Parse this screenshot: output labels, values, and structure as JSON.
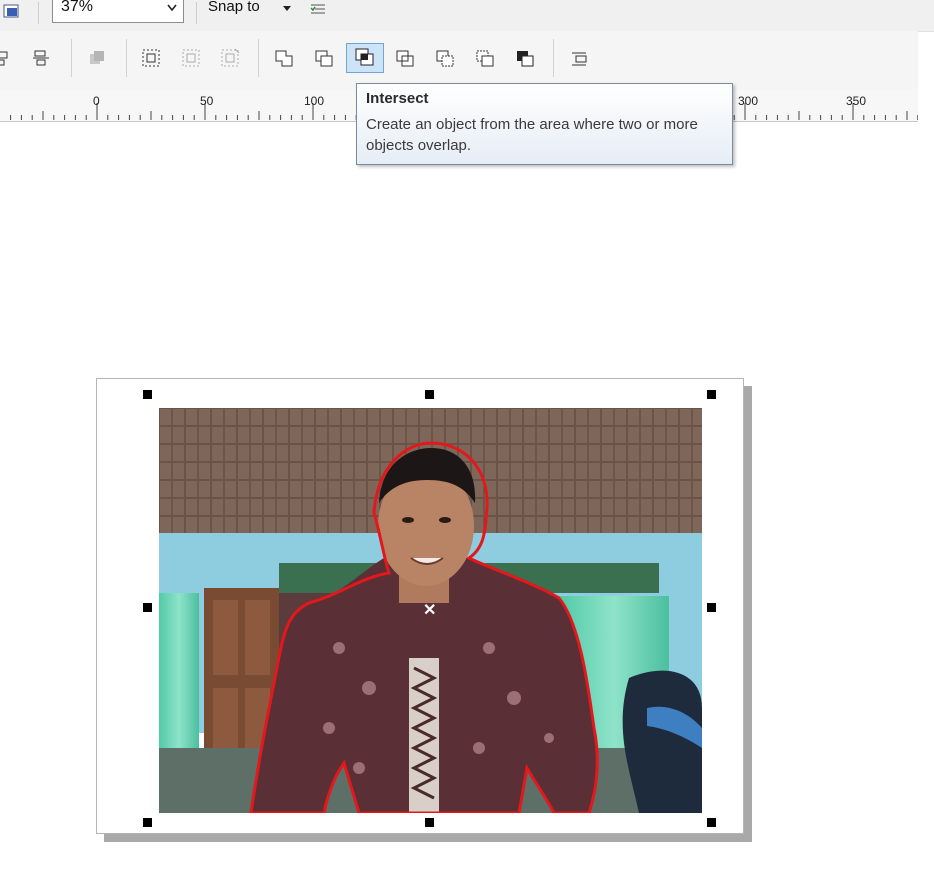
{
  "property_bar": {
    "zoom_value": "37%",
    "snap_label": "Snap to"
  },
  "toolbar": {
    "buttons": [
      "align-distribute",
      "align-page",
      "combine",
      "group",
      "ungroup",
      "ungroup-all",
      "weld",
      "trim",
      "intersect",
      "simplify",
      "front-minus-back",
      "back-minus-front",
      "boundary",
      "create-boundary"
    ],
    "active_button": "intersect"
  },
  "ruler": {
    "labels": [
      "0",
      "50",
      "100",
      "300",
      "350"
    ]
  },
  "tooltip": {
    "title": "Intersect",
    "description": "Create an object from the area where two or more objects overlap."
  },
  "colors": {
    "selection_outline": "#e4181c",
    "tooltip_border": "#7a8ba0",
    "active_button_bg": "#cde3f7"
  }
}
